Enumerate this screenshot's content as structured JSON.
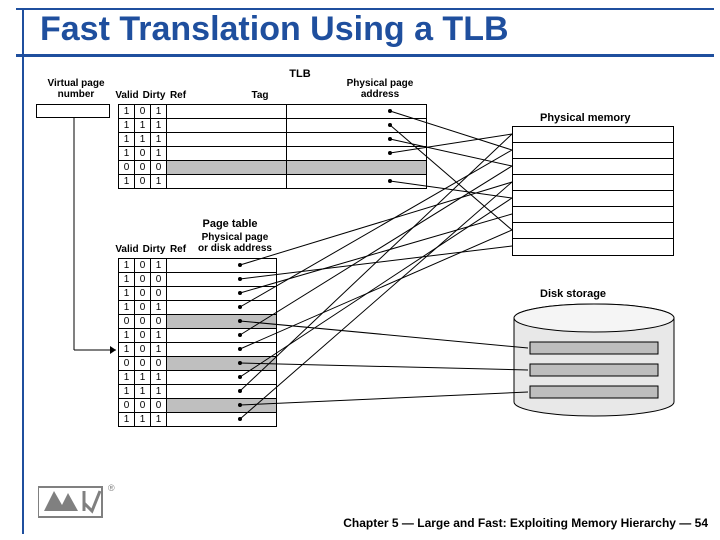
{
  "title": "Fast Translation Using a TLB",
  "labels": {
    "tlb": "TLB",
    "virtual_page_number": "Virtual page\nnumber",
    "valid": "Valid",
    "dirty": "Dirty",
    "ref": "Ref",
    "tag": "Tag",
    "physical_page_address": "Physical page\naddress",
    "physical_memory": "Physical memory",
    "page_table": "Page table",
    "physical_page_or_disk": "Physical page\nor disk address",
    "disk_storage": "Disk storage"
  },
  "tlb_rows": [
    {
      "v": "1",
      "d": "0",
      "r": "1",
      "gray": false
    },
    {
      "v": "1",
      "d": "1",
      "r": "1",
      "gray": false
    },
    {
      "v": "1",
      "d": "1",
      "r": "1",
      "gray": false
    },
    {
      "v": "1",
      "d": "0",
      "r": "1",
      "gray": false
    },
    {
      "v": "0",
      "d": "0",
      "r": "0",
      "gray": true
    },
    {
      "v": "1",
      "d": "0",
      "r": "1",
      "gray": false
    }
  ],
  "page_table_rows": [
    {
      "v": "1",
      "d": "0",
      "r": "1",
      "gray": false
    },
    {
      "v": "1",
      "d": "0",
      "r": "0",
      "gray": false
    },
    {
      "v": "1",
      "d": "0",
      "r": "0",
      "gray": false
    },
    {
      "v": "1",
      "d": "0",
      "r": "1",
      "gray": false
    },
    {
      "v": "0",
      "d": "0",
      "r": "0",
      "gray": true
    },
    {
      "v": "1",
      "d": "0",
      "r": "1",
      "gray": false
    },
    {
      "v": "1",
      "d": "0",
      "r": "1",
      "gray": false
    },
    {
      "v": "0",
      "d": "0",
      "r": "0",
      "gray": true
    },
    {
      "v": "1",
      "d": "1",
      "r": "1",
      "gray": false
    },
    {
      "v": "1",
      "d": "1",
      "r": "1",
      "gray": false
    },
    {
      "v": "0",
      "d": "0",
      "r": "0",
      "gray": true
    },
    {
      "v": "1",
      "d": "1",
      "r": "1",
      "gray": false
    }
  ],
  "footer": "Chapter 5 — Large and Fast: Exploiting Memory Hierarchy — 54",
  "logo_r": "®"
}
